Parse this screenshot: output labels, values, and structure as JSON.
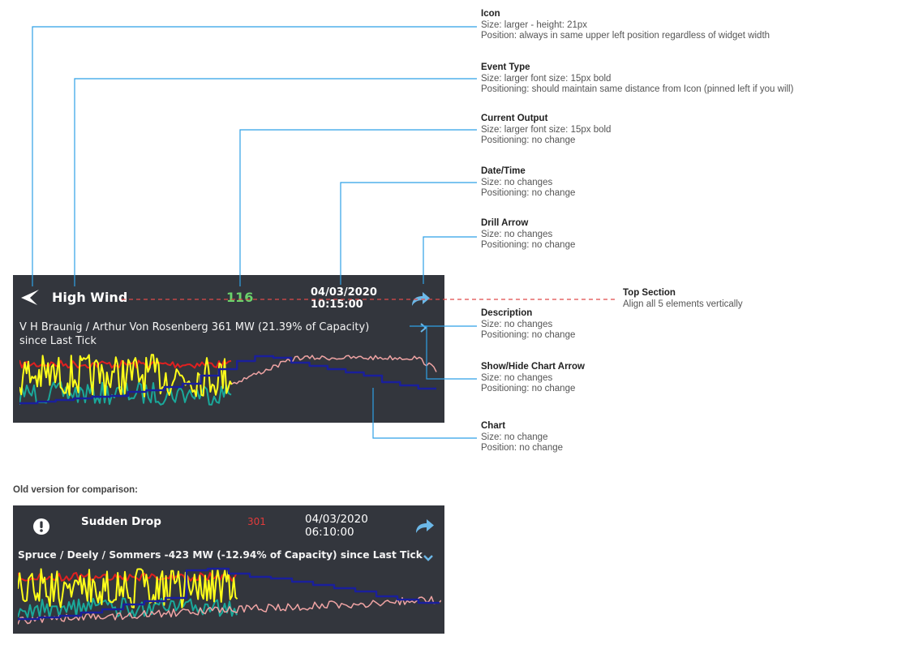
{
  "new_widget": {
    "event_type": "High Wind",
    "output": "116",
    "output_color": "#6bd36b",
    "date": "04/03/2020",
    "time": "10:15:00",
    "description_line1": "V H Braunig / Arthur Von Rosenberg 361 MW (21.39% of Capacity)",
    "description_line2": "since Last Tick",
    "icon": "wind-arrow-icon",
    "drill_icon": "share-arrow-icon",
    "chart_toggle_icon": "chevron-right-icon"
  },
  "old_widget": {
    "label": "Old version for comparison:",
    "event_type": "Sudden Drop",
    "output": "301",
    "output_color": "#e23b3b",
    "date": "04/03/2020",
    "time": "06:10:00",
    "description": "Spruce / Deely / Sommers -423 MW (-12.94% of Capacity) since Last Tick",
    "icon": "exclamation-circle-icon",
    "drill_icon": "share-arrow-icon",
    "chart_toggle_icon": "chevron-down-icon"
  },
  "colors": {
    "panel": "#33363d",
    "annotation_line": "#2ea0e6",
    "top_section_dash": "#e04a4a",
    "series_yellow": "#ffff1a",
    "series_red": "#e02020",
    "series_teal": "#1aa89a",
    "series_navy": "#1a1f9c",
    "series_pink": "#f0a4a4",
    "drill_arrow": "#6cb8e8"
  },
  "annotations": {
    "icon": {
      "title": "Icon",
      "l1": "Size: larger - height: 21px",
      "l2": "Position: always in same upper left position regardless of widget width"
    },
    "event_type": {
      "title": "Event Type",
      "l1": "Size: larger font size: 15px bold",
      "l2": "Positioning: should maintain same distance from Icon (pinned left if you will)"
    },
    "current_output": {
      "title": "Current Output",
      "l1": "Size: larger font size: 15px bold",
      "l2": "Positioning: no change"
    },
    "date_time": {
      "title": "Date/Time",
      "l1": "Size: no changes",
      "l2": "Positioning: no change"
    },
    "drill_arrow": {
      "title": "Drill Arrow",
      "l1": "Size: no changes",
      "l2": "Positioning: no change"
    },
    "top_section": {
      "title": "Top Section",
      "l1": "Align all 5 elements vertically"
    },
    "description": {
      "title": "Description",
      "l1": "Size: no changes",
      "l2": "Positioning: no change"
    },
    "show_hide": {
      "title": "Show/Hide Chart Arrow",
      "l1": "Size: no changes",
      "l2": "Positioning: no change"
    },
    "chart": {
      "title": "Chart",
      "l1": "Size: no change",
      "l2": "Position: no change"
    }
  }
}
